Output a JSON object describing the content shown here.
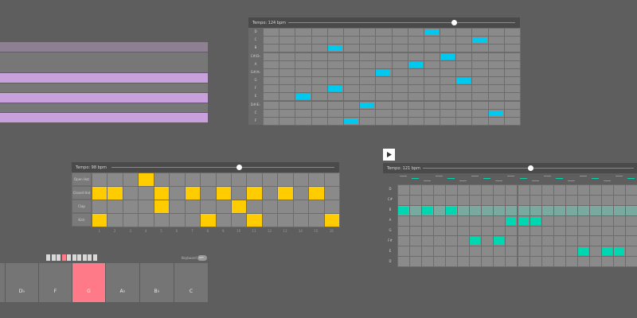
{
  "colors": {
    "background": "#5e5e5e",
    "header": "#4a4a4a",
    "grid_cell": "#8a8a8a",
    "grid_line": "#6c6c6c",
    "lavender": "#c7a0dc",
    "blue_note": "#00c8ee",
    "yellow_note": "#ffcc00",
    "teal_note": "#00d6b0",
    "pink_key": "#ff7a88",
    "key_gray": "#757575"
  },
  "melody_sequencer": {
    "tempo": "Tempo: 124 bpm",
    "tempo_fraction": 0.73,
    "row_labels": [
      "D",
      "C",
      "B",
      "C#/D♭",
      "A",
      "G#/A♭",
      "G",
      "F",
      "E",
      "D#/E♭",
      "C",
      "F"
    ],
    "columns": 16,
    "notes": [
      [
        0,
        10
      ],
      [
        1,
        13
      ],
      [
        2,
        4
      ],
      [
        3,
        11
      ],
      [
        4,
        9
      ],
      [
        5,
        7
      ],
      [
        6,
        12
      ],
      [
        7,
        4
      ],
      [
        8,
        2
      ],
      [
        9,
        6
      ],
      [
        10,
        14
      ],
      [
        11,
        5
      ]
    ]
  },
  "drum_sequencer": {
    "tempo": "Tempo: 98 bpm",
    "tempo_fraction": 0.57,
    "rows": [
      "Open Hat",
      "Closed Hat",
      "Clap",
      "Kick"
    ],
    "steps": [
      "1",
      "2",
      "3",
      "4",
      "5",
      "6",
      "7",
      "8",
      "9",
      "10",
      "11",
      "12",
      "13",
      "14",
      "15",
      "16"
    ],
    "pattern": [
      [
        3
      ],
      [
        0,
        1,
        4,
        6,
        8,
        10,
        12,
        14
      ],
      [
        4,
        9
      ],
      [
        0,
        7,
        10,
        15
      ]
    ]
  },
  "arpeggio_sequencer": {
    "play_icon": "play-icon",
    "tempo": "Tempo: 121 bpm",
    "tempo_fraction": 0.51,
    "row_labels": [
      "D",
      "C#",
      "B",
      "A",
      "G",
      "F#",
      "E",
      "D"
    ],
    "columns": 20,
    "highlight_row": 2,
    "notes": [
      [
        2,
        0
      ],
      [
        2,
        2
      ],
      [
        2,
        4
      ],
      [
        3,
        9
      ],
      [
        3,
        10
      ],
      [
        3,
        11
      ],
      [
        5,
        6
      ],
      [
        5,
        8
      ],
      [
        6,
        15
      ],
      [
        6,
        17
      ],
      [
        6,
        18
      ]
    ]
  },
  "lavender_strips": {
    "rows": [
      "#8e7f92",
      "#757575",
      "#c7a0dc",
      "#c7a0dc",
      "#c7a0dc"
    ]
  },
  "keyboard": {
    "keys": [
      {
        "label": "",
        "color": "#757575"
      },
      {
        "label": "D♭",
        "color": "#757575"
      },
      {
        "label": "F",
        "color": "#757575"
      },
      {
        "label": "G",
        "color": "#ff7a88"
      },
      {
        "label": "A♭",
        "color": "#757575"
      },
      {
        "label": "B♭",
        "color": "#757575"
      },
      {
        "label": "C",
        "color": "#757575"
      }
    ],
    "keyboard_toggle_label": "Keyboard",
    "toggle_state": "OFF"
  }
}
